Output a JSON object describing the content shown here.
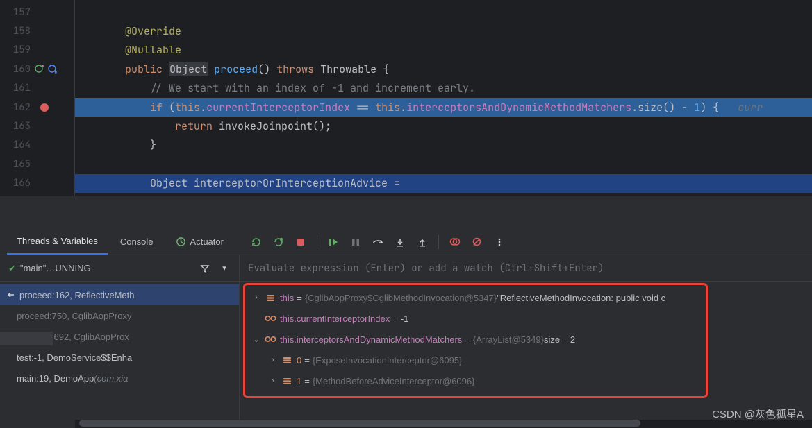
{
  "editor": {
    "lines": [
      {
        "num": "157",
        "segments": []
      },
      {
        "num": "158",
        "segments": [
          {
            "cls": "ann",
            "t": "        @Override"
          }
        ]
      },
      {
        "num": "159",
        "segments": [
          {
            "cls": "ann",
            "t": "        @Nullable"
          }
        ]
      },
      {
        "num": "160",
        "icons": [
          "override-up",
          "override-down"
        ],
        "segments": [
          {
            "cls": "plain",
            "t": "        "
          },
          {
            "cls": "kw",
            "t": "public"
          },
          {
            "cls": "plain",
            "t": " "
          },
          {
            "cls": "type-box",
            "t": "Object"
          },
          {
            "cls": "plain",
            "t": " "
          },
          {
            "cls": "fn",
            "t": "proceed"
          },
          {
            "cls": "plain",
            "t": "() "
          },
          {
            "cls": "kw",
            "t": "throws"
          },
          {
            "cls": "plain",
            "t": " Throwable {"
          }
        ]
      },
      {
        "num": "161",
        "segments": [
          {
            "cls": "plain",
            "t": "            "
          },
          {
            "cls": "comment",
            "t": "// We start with an index of -1 and increment early."
          }
        ]
      },
      {
        "num": "162",
        "breakpoint": true,
        "highlight": "execution",
        "segments": [
          {
            "cls": "plain",
            "t": "            "
          },
          {
            "cls": "kw",
            "t": "if"
          },
          {
            "cls": "plain",
            "t": " ("
          },
          {
            "cls": "kw",
            "t": "this"
          },
          {
            "cls": "plain",
            "t": "."
          },
          {
            "cls": "field",
            "t": "currentInterceptorIndex"
          },
          {
            "cls": "plain",
            "t": " == "
          },
          {
            "cls": "kw",
            "t": "this"
          },
          {
            "cls": "plain",
            "t": "."
          },
          {
            "cls": "field",
            "t": "interceptorsAndDynamicMethodMatchers"
          },
          {
            "cls": "plain",
            "t": ".size() - "
          },
          {
            "cls": "num",
            "t": "1"
          },
          {
            "cls": "plain",
            "t": ") {   "
          },
          {
            "cls": "dim-hint",
            "t": "curr"
          }
        ]
      },
      {
        "num": "163",
        "segments": [
          {
            "cls": "plain",
            "t": "                "
          },
          {
            "cls": "kw",
            "t": "return"
          },
          {
            "cls": "plain",
            "t": " invokeJoinpoint();"
          }
        ]
      },
      {
        "num": "164",
        "segments": [
          {
            "cls": "plain",
            "t": "            }"
          }
        ]
      },
      {
        "num": "165",
        "segments": []
      },
      {
        "num": "166",
        "highlight": "selected",
        "segments": [
          {
            "cls": "plain",
            "t": "            Object interceptorOrInterceptionAdvice ="
          }
        ]
      }
    ]
  },
  "debugTabs": {
    "threads": "Threads & Variables",
    "console": "Console",
    "actuator": "Actuator"
  },
  "frames": {
    "thread": "\"main\"…UNNING",
    "items": [
      {
        "label": "proceed:162, ReflectiveMeth",
        "selected": true,
        "back": true
      },
      {
        "label": "proceed:750, CglibAopProxy",
        "dim": true
      },
      {
        "label": "intercept:692, CglibAopProx",
        "dim": true
      },
      {
        "label": "test:-1, DemoService$$Enha"
      },
      {
        "label": "main:19, DemoApp ",
        "loc": "(com.xia"
      }
    ]
  },
  "evalPlaceholder": "Evaluate expression (Enter) or add a watch (Ctrl+Shift+Enter)",
  "vars": [
    {
      "arrow": "right",
      "icon": "obj",
      "name": "this",
      "eq": " = ",
      "type": "{CglibAopProxy$CglibMethodInvocation@5347}",
      "val": " \"ReflectiveMethodInvocation: public void c"
    },
    {
      "arrow": "",
      "icon": "glasses",
      "name": "this.currentInterceptorIndex",
      "eq": " = ",
      "val2": "-1"
    },
    {
      "arrow": "down",
      "icon": "glasses",
      "name": "this.interceptorsAndDynamicMethodMatchers",
      "eq": " = ",
      "type": "{ArrayList@5349}",
      "val": "  size = 2"
    },
    {
      "indent": 1,
      "arrow": "right",
      "icon": "obj",
      "nameOrange": "0",
      "eq": " = ",
      "type": "{ExposeInvocationInterceptor@6095}"
    },
    {
      "indent": 1,
      "arrow": "right",
      "icon": "obj",
      "nameOrange": "1",
      "eq": " = ",
      "type": "{MethodBeforeAdviceInterceptor@6096}"
    }
  ],
  "watermark": "CSDN @灰色孤星A"
}
